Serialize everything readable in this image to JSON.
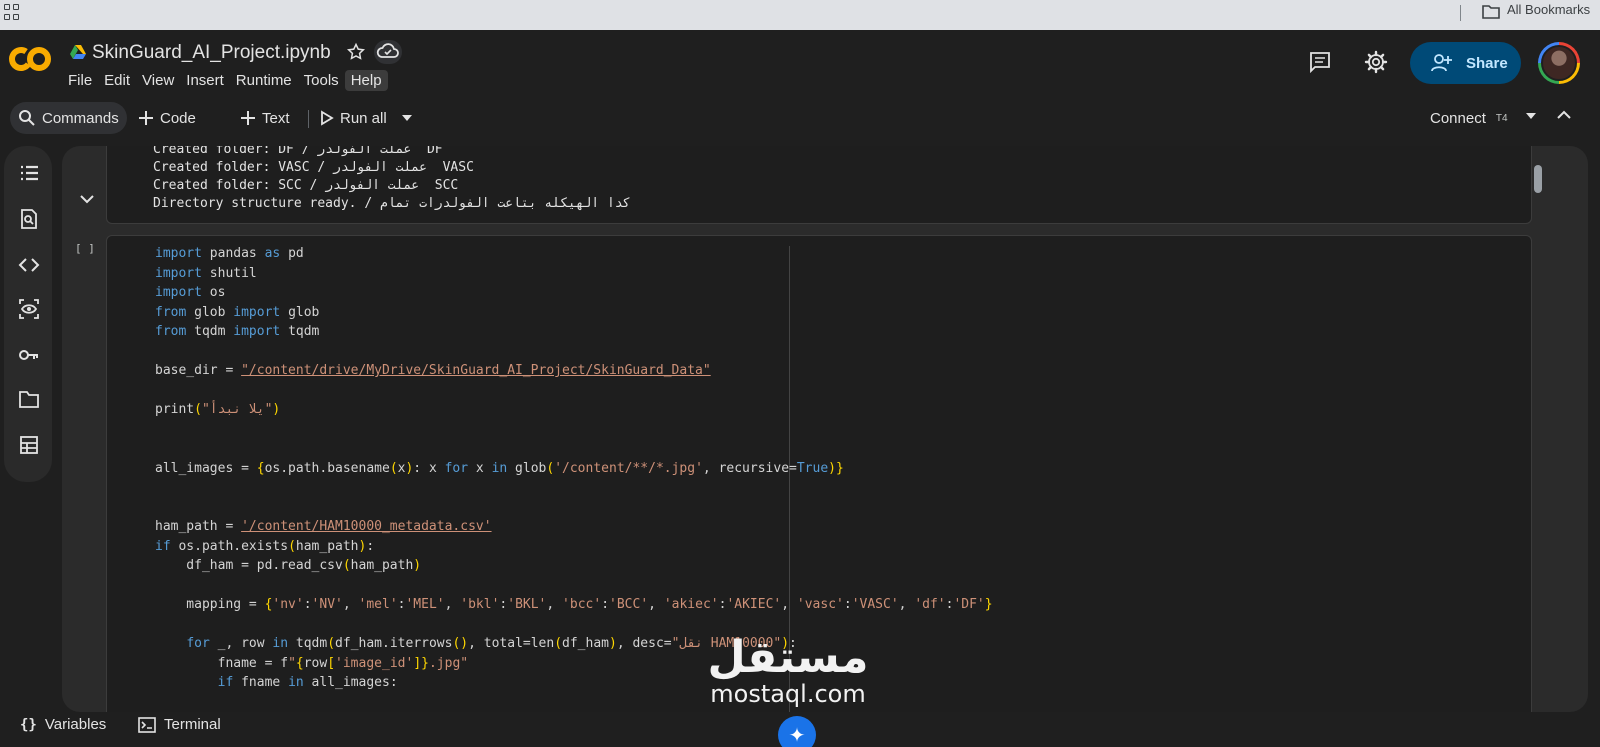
{
  "browser": {
    "bookmarks_label": "All Bookmarks"
  },
  "header": {
    "file_title": "SkinGuard_AI_Project.ipynb",
    "menu": [
      "File",
      "Edit",
      "View",
      "Insert",
      "Runtime",
      "Tools",
      "Help"
    ],
    "share_label": "Share"
  },
  "toolbar": {
    "commands_label": "Commands",
    "code_label": "Code",
    "text_label": "Text",
    "run_all_label": "Run all",
    "connect_label": "Connect",
    "runtime_badge": "T4"
  },
  "output_cell": {
    "lines": [
      "Created folder: DF / عملت الفولدر  DF",
      "Created folder: VASC / عملت الفولدر  VASC",
      "Created folder: SCC / عملت الفولدر  SCC",
      "Directory structure ready. / كدا الهيكله بتاعت الفولدرات تمام"
    ]
  },
  "code_cell": {
    "exec_marker": "[ ]"
  },
  "bottom_bar": {
    "variables_label": "Variables",
    "terminal_label": "Terminal"
  },
  "watermark": {
    "arabic": "مستقل",
    "latin": "mostaql.com"
  },
  "icons": {
    "sidebar": [
      "toc-icon",
      "find-icon",
      "code-snippets-icon",
      "variables-inspector-icon",
      "secrets-key-icon",
      "files-folder-icon",
      "data-table-icon"
    ],
    "header": [
      "comment-icon",
      "settings-gear-icon",
      "share-people-icon"
    ]
  }
}
